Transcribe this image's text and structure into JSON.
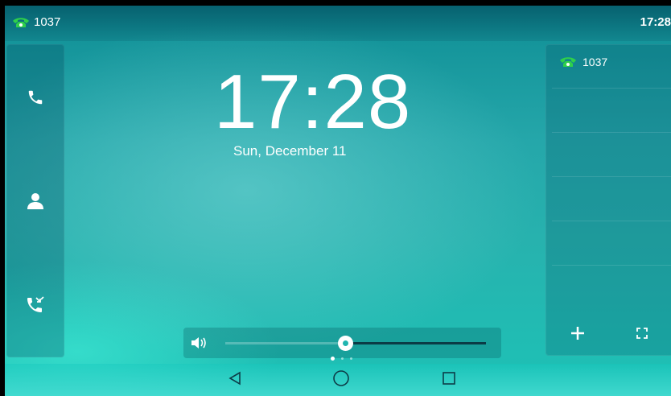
{
  "status_bar": {
    "account": "1037",
    "time": "17:28",
    "account_icon": "phone-registered-icon"
  },
  "clock": {
    "time": "17:28",
    "date": "Sun, December 11"
  },
  "left_bar": {
    "items": [
      {
        "name": "dial",
        "icon": "phone-icon"
      },
      {
        "name": "directory",
        "icon": "contact-icon"
      },
      {
        "name": "history",
        "icon": "call-history-icon"
      }
    ]
  },
  "right_panel": {
    "line_key": {
      "label": "1037",
      "icon": "phone-registered-icon"
    },
    "footer": {
      "add_icon": "plus-icon",
      "expand_icon": "fullscreen-icon"
    }
  },
  "volume": {
    "level": 0.46,
    "icon": "speaker-icon"
  },
  "pager": {
    "pages": 3,
    "active": 0
  },
  "nav": {
    "back_icon": "back-triangle-icon",
    "home_icon": "home-circle-icon",
    "recent_icon": "recent-square-icon"
  },
  "colors": {
    "registered": "#2fd04a",
    "accent": "#20b5b0"
  }
}
